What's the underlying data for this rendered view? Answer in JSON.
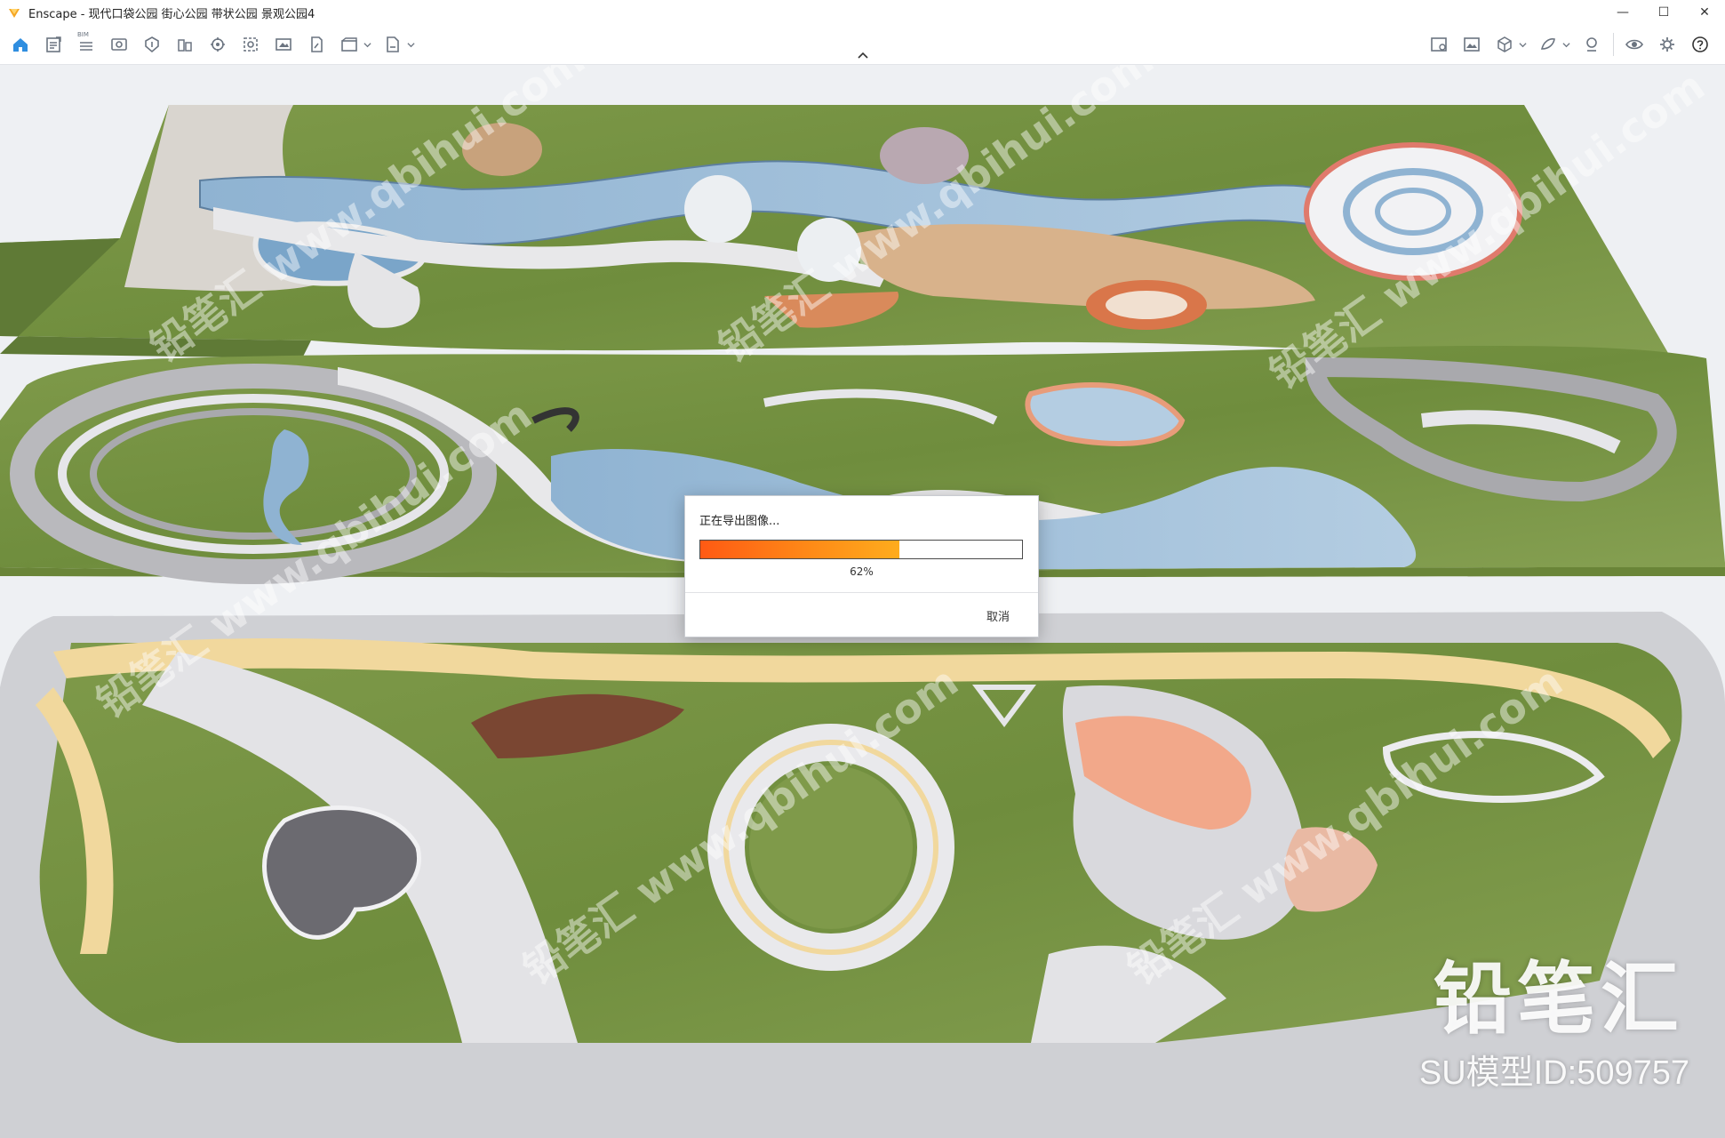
{
  "window": {
    "app_name": "Enscape",
    "title": "Enscape - 现代口袋公园 街心公园 带状公园 景观公园4",
    "controls": {
      "minimize": "—",
      "maximize": "☐",
      "close": "✕"
    }
  },
  "toolbar": {
    "left_icons": [
      "home-icon",
      "notes-icon",
      "bim-icon",
      "view-icon",
      "visibility-icon",
      "site-icon",
      "asset-library-icon",
      "settings-gear-icon",
      "screenshot-icon",
      "image-icon",
      "video-icon",
      "panorama-icon",
      "export-icon"
    ],
    "bim_label": "BIM",
    "right_icons": [
      "material-editor-icon",
      "visual-settings-icon",
      "cube-icon",
      "feedback-icon",
      "account-icon",
      "eye-icon",
      "preferences-icon",
      "help-icon"
    ],
    "accent_color": "#2f8ee0"
  },
  "render": {
    "watermark_text": "铅笔汇 www.qbihui.com",
    "brand": "铅笔汇",
    "model_id": "SU模型ID:509757"
  },
  "dialog": {
    "title": "正在导出图像...",
    "progress_percent": 62,
    "progress_label": "62%",
    "cancel_label": "取消",
    "fill_color": "#ff7a16"
  }
}
